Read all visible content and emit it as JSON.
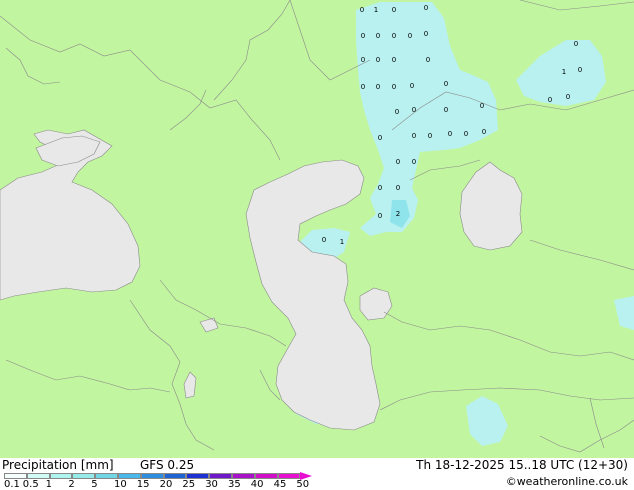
{
  "legend": {
    "title": "Precipitation [mm]",
    "model": "GFS 0.25",
    "ticks": [
      "0.1",
      "0.5",
      "1",
      "2",
      "5",
      "10",
      "15",
      "20",
      "25",
      "30",
      "35",
      "40",
      "45",
      "50"
    ],
    "colors": [
      "#f4fffd",
      "#d1fbf6",
      "#b0f4ef",
      "#96ebe8",
      "#73d6e5",
      "#4ab6ea",
      "#2d8ee0",
      "#1f62d4",
      "#1c2fd0",
      "#6e18c9",
      "#a812c8",
      "#d00ec7",
      "#e80fd0"
    ]
  },
  "valid_time": "Th 18-12-2025 15..18 UTC (12+30)",
  "credit": "©weatheronline.co.uk",
  "map": {
    "land_color": "#c2f5a0",
    "water_color": "#e8e8e8",
    "precip_light": "#b8f1f0",
    "precip_mid": "#8fe3ea",
    "point_labels": [
      "0",
      "1",
      "0",
      "0",
      "0",
      "0",
      "0",
      "0",
      "0",
      "0",
      "0",
      "0",
      "0",
      "0",
      "0",
      "0",
      "0",
      "0",
      "0",
      "0",
      "0",
      "0",
      "0",
      "0",
      "0",
      "0",
      "0",
      "0",
      "0",
      "0",
      "0",
      "0",
      "2",
      "0",
      "1",
      "0",
      "0",
      "0",
      "1",
      "0",
      "0"
    ]
  }
}
